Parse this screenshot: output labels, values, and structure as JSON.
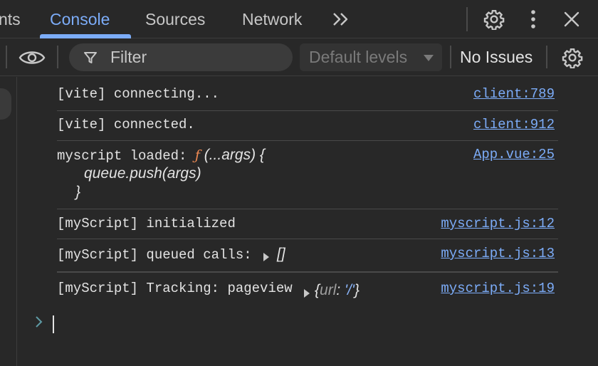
{
  "tabs": [
    {
      "label": "nts",
      "active": false
    },
    {
      "label": "Console",
      "active": true
    },
    {
      "label": "Sources",
      "active": false
    },
    {
      "label": "Network",
      "active": false
    }
  ],
  "tabbar": {
    "more_icon": "chevrons-right-icon",
    "settings_icon": "gear-icon",
    "menu_icon": "kebab-menu-icon",
    "close_icon": "close-icon"
  },
  "toolbar": {
    "eye_icon": "eye-icon",
    "filter_placeholder": "Filter",
    "levels_label": "Default levels",
    "issues_label": "No Issues",
    "settings_icon": "gear-icon"
  },
  "messages": [
    {
      "text": "[vite] connecting...",
      "source": "client:789"
    },
    {
      "text": "[vite] connected.",
      "source": "client:912"
    },
    {
      "prefix": "myscript loaded: ",
      "keyword": "ƒ",
      "sig": " (...args) {",
      "body": "queue.push(args)",
      "close": "}",
      "source": "App.vue:25"
    },
    {
      "text": "[myScript] initialized",
      "source": "myscript.js:12"
    },
    {
      "text": "[myScript] queued calls: ",
      "value": "[]",
      "source": "myscript.js:13"
    },
    {
      "text": "[myScript] Tracking: pageview",
      "obj_open": "{",
      "obj_key": "url",
      "obj_colon": ": ",
      "obj_val": "'/'",
      "obj_close": "}",
      "source": "myscript.js:19"
    }
  ],
  "colors": {
    "background": "#282828",
    "accent": "#7cacf8",
    "function_keyword": "#f28b54"
  }
}
